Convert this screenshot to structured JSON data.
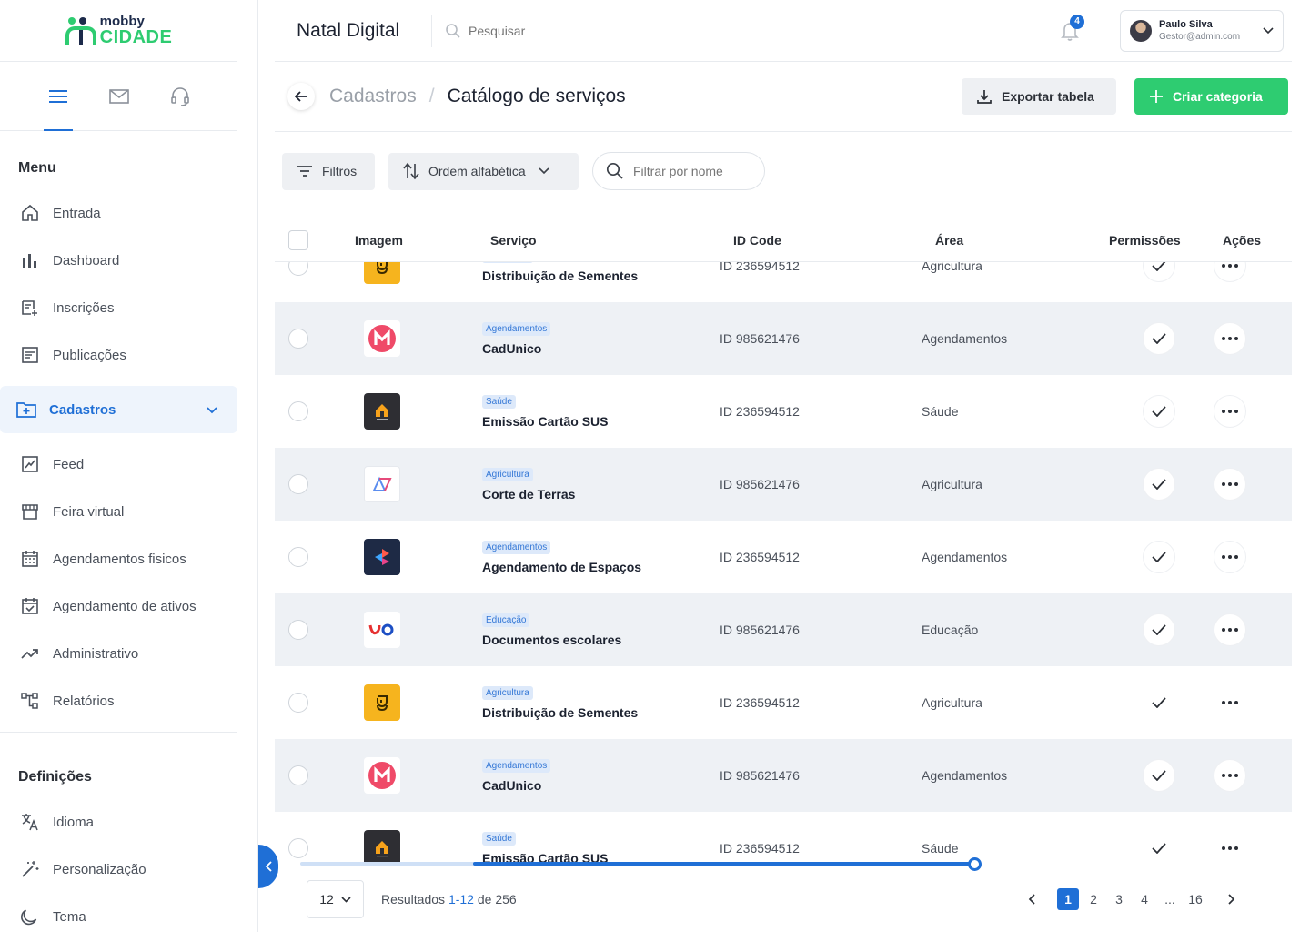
{
  "logo": {
    "line1": "mobby",
    "line2": "CIDADE"
  },
  "sidebar": {
    "tabs": [
      "menu-icon",
      "mail-icon",
      "headset-icon"
    ],
    "menu_title": "Menu",
    "items": [
      {
        "label": "Entrada",
        "icon": "home-icon"
      },
      {
        "label": "Dashboard",
        "icon": "bar-chart-icon"
      },
      {
        "label": "Inscrições",
        "icon": "list-add-icon"
      },
      {
        "label": "Publicações",
        "icon": "document-icon"
      },
      {
        "label": "Cadastros",
        "icon": "folder-add-icon",
        "active": true
      },
      {
        "label": "Feed",
        "icon": "feed-icon"
      },
      {
        "label": "Feira virtual",
        "icon": "store-icon"
      },
      {
        "label": "Agendamentos fisicos",
        "icon": "calendar-icon"
      },
      {
        "label": "Agendamento de ativos",
        "icon": "calendar-check-icon"
      },
      {
        "label": "Administrativo",
        "icon": "trend-icon"
      },
      {
        "label": "Relatórios",
        "icon": "flow-icon"
      }
    ],
    "settings_title": "Definições",
    "settings_items": [
      {
        "label": "Idioma",
        "icon": "translate-icon"
      },
      {
        "label": "Personalização",
        "icon": "wand-icon"
      },
      {
        "label": "Tema",
        "icon": "moon-icon"
      }
    ]
  },
  "topbar": {
    "title": "Natal Digital",
    "search_placeholder": "Pesquisar",
    "notifications": "4",
    "user_name": "Paulo Silva",
    "user_email": "Gestor@admin.com"
  },
  "page": {
    "crumb_parent": "Cadastros",
    "crumb_sep": "/",
    "crumb_current": "Catálogo de serviços",
    "export_label": "Exportar tabela",
    "create_label": "Criar categoria"
  },
  "filters": {
    "filters_label": "Filtros",
    "sort_label": "Ordem alfabética",
    "name_placeholder": "Filtrar por nome"
  },
  "table": {
    "headers": {
      "image": "Imagem",
      "service": "Serviço",
      "id": "ID Code",
      "area": "Área",
      "permissions": "Permissões",
      "actions": "Ações"
    },
    "rows": [
      {
        "tag": "Agricultura",
        "name": "Distribuição de Sementes",
        "id": "ID 236594512",
        "area": "Agricultura",
        "thumb": "seed-logo",
        "shaded": false,
        "btn": true
      },
      {
        "tag": "Agendamentos",
        "name": "CadUnico",
        "id": "ID 985621476",
        "area": "Agendamentos",
        "thumb": "m-logo",
        "shaded": true,
        "btn": true
      },
      {
        "tag": "Saúde",
        "name": "Emissão Cartão SUS",
        "id": "ID 236594512",
        "area": "Sáude",
        "thumb": "house-logo",
        "shaded": false,
        "btn": true
      },
      {
        "tag": "Agricultura",
        "name": "Corte de Terras",
        "id": "ID 985621476",
        "area": "Agricultura",
        "thumb": "triangle-logo",
        "shaded": true,
        "btn": true
      },
      {
        "tag": "Agendamentos",
        "name": "Agendamento de Espaços",
        "id": "ID 236594512",
        "area": "Agendamentos",
        "thumb": "cube-logo",
        "shaded": false,
        "btn": true
      },
      {
        "tag": "Educação",
        "name": "Documentos escolares",
        "id": "ID 985621476",
        "area": "Educação",
        "thumb": "uo-logo",
        "shaded": true,
        "btn": true
      },
      {
        "tag": "Agricultura",
        "name": "Distribuição de Sementes",
        "id": "ID 236594512",
        "area": "Agricultura",
        "thumb": "seed-logo",
        "shaded": false,
        "btn": false
      },
      {
        "tag": "Agendamentos",
        "name": "CadUnico",
        "id": "ID 985621476",
        "area": "Agendamentos",
        "thumb": "m-logo",
        "shaded": true,
        "btn": true
      },
      {
        "tag": "Saúde",
        "name": "Emissão Cartão SUS",
        "id": "ID 236594512",
        "area": "Sáude",
        "thumb": "house-logo",
        "shaded": false,
        "btn": false
      }
    ]
  },
  "footer": {
    "per_page": "12",
    "results_prefix": "Resultados ",
    "results_range": "1-12",
    "results_suffix": " de 256",
    "pages": [
      "1",
      "2",
      "3",
      "4",
      "...",
      "16"
    ]
  },
  "colors": {
    "primary": "#1f6fd6",
    "success": "#2ecc71"
  }
}
